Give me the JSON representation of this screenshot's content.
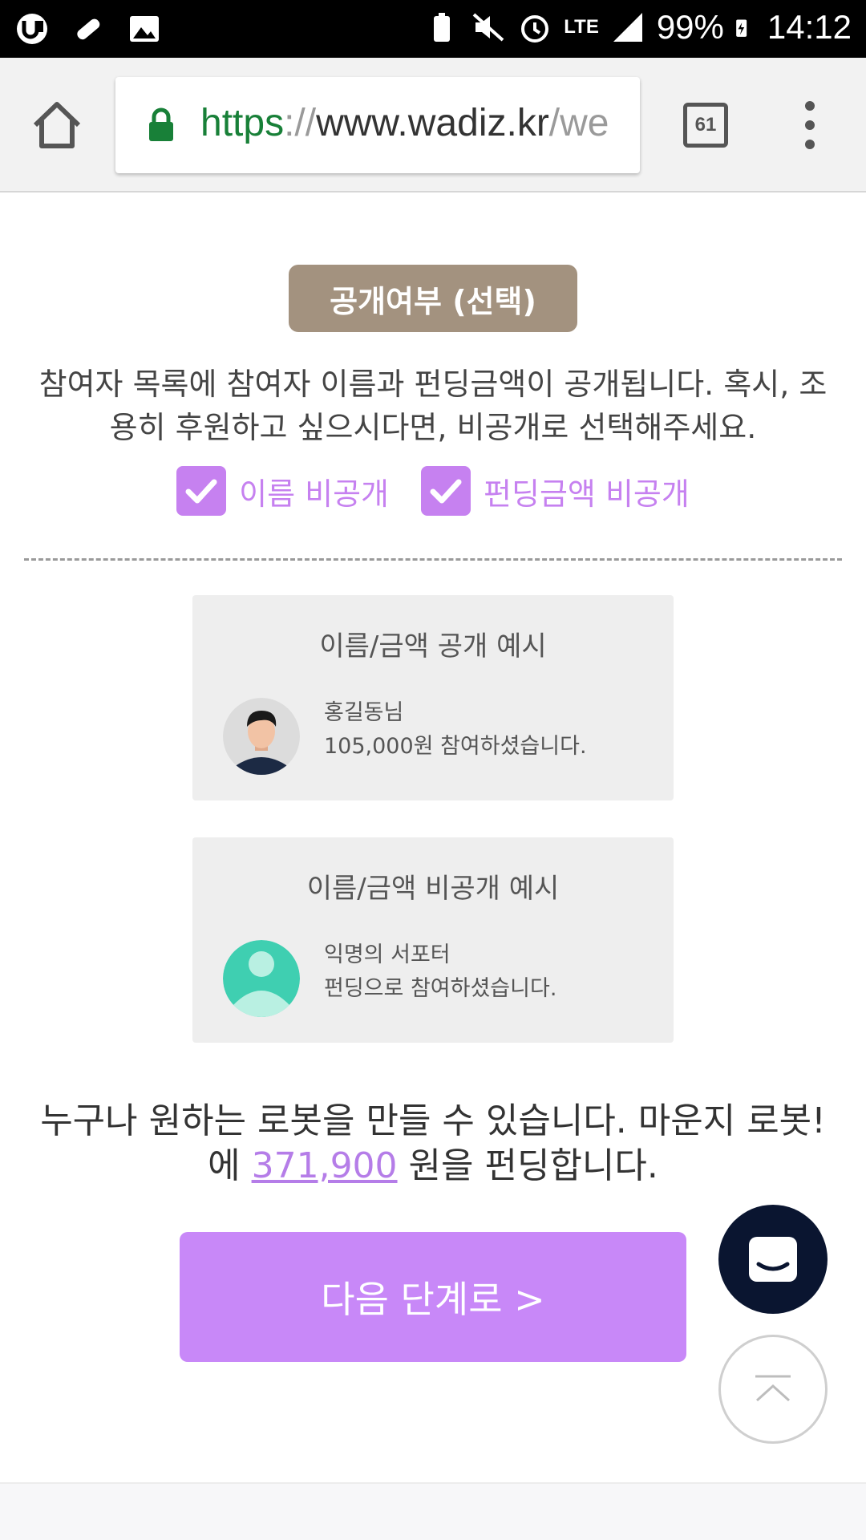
{
  "status_bar": {
    "battery": "99%",
    "time": "14:12",
    "network": "LTE",
    "icons": [
      "u-plus-icon",
      "bandage-icon",
      "image-icon",
      "battery-saver-icon",
      "mute-icon",
      "alarm-icon",
      "lte-icon",
      "signal-icon",
      "battery-charging-icon"
    ]
  },
  "browser": {
    "url_scheme": "https",
    "url_sep": "://",
    "url_host": "www.wadiz.kr",
    "url_rest": "/we",
    "tab_count": "61"
  },
  "privacy": {
    "title": "공개여부 (선택)",
    "description": "참여자 목록에 참여자 이름과 펀딩금액이 공개됩니다. 혹시, 조용히 후원하고 싶으시다면, 비공개로 선택해주세요.",
    "name_private_label": "이름 비공개",
    "amount_private_label": "펀딩금액 비공개",
    "name_private_checked": true,
    "amount_private_checked": true
  },
  "examples": {
    "public": {
      "title": "이름/금액 공개 예시",
      "line1": "홍길동님",
      "line2": "105,000원 참여하셨습니다."
    },
    "private": {
      "title": "이름/금액 비공개 예시",
      "line1": "익명의 서포터",
      "line2": "펀딩으로 참여하셨습니다."
    }
  },
  "summary": {
    "prefix": "누구나 원하는 로봇을 만들 수 있습니다. 마운지 로봇!에 ",
    "amount": "371,900",
    "suffix": " 원을 펀딩합니다."
  },
  "actions": {
    "next_label": "다음 단계로 >"
  },
  "colors": {
    "accent": "#c681f0",
    "badge": "#a3927f",
    "button": "#c888f8",
    "chat_fab": "#0a1530",
    "secure_green": "#188038"
  }
}
